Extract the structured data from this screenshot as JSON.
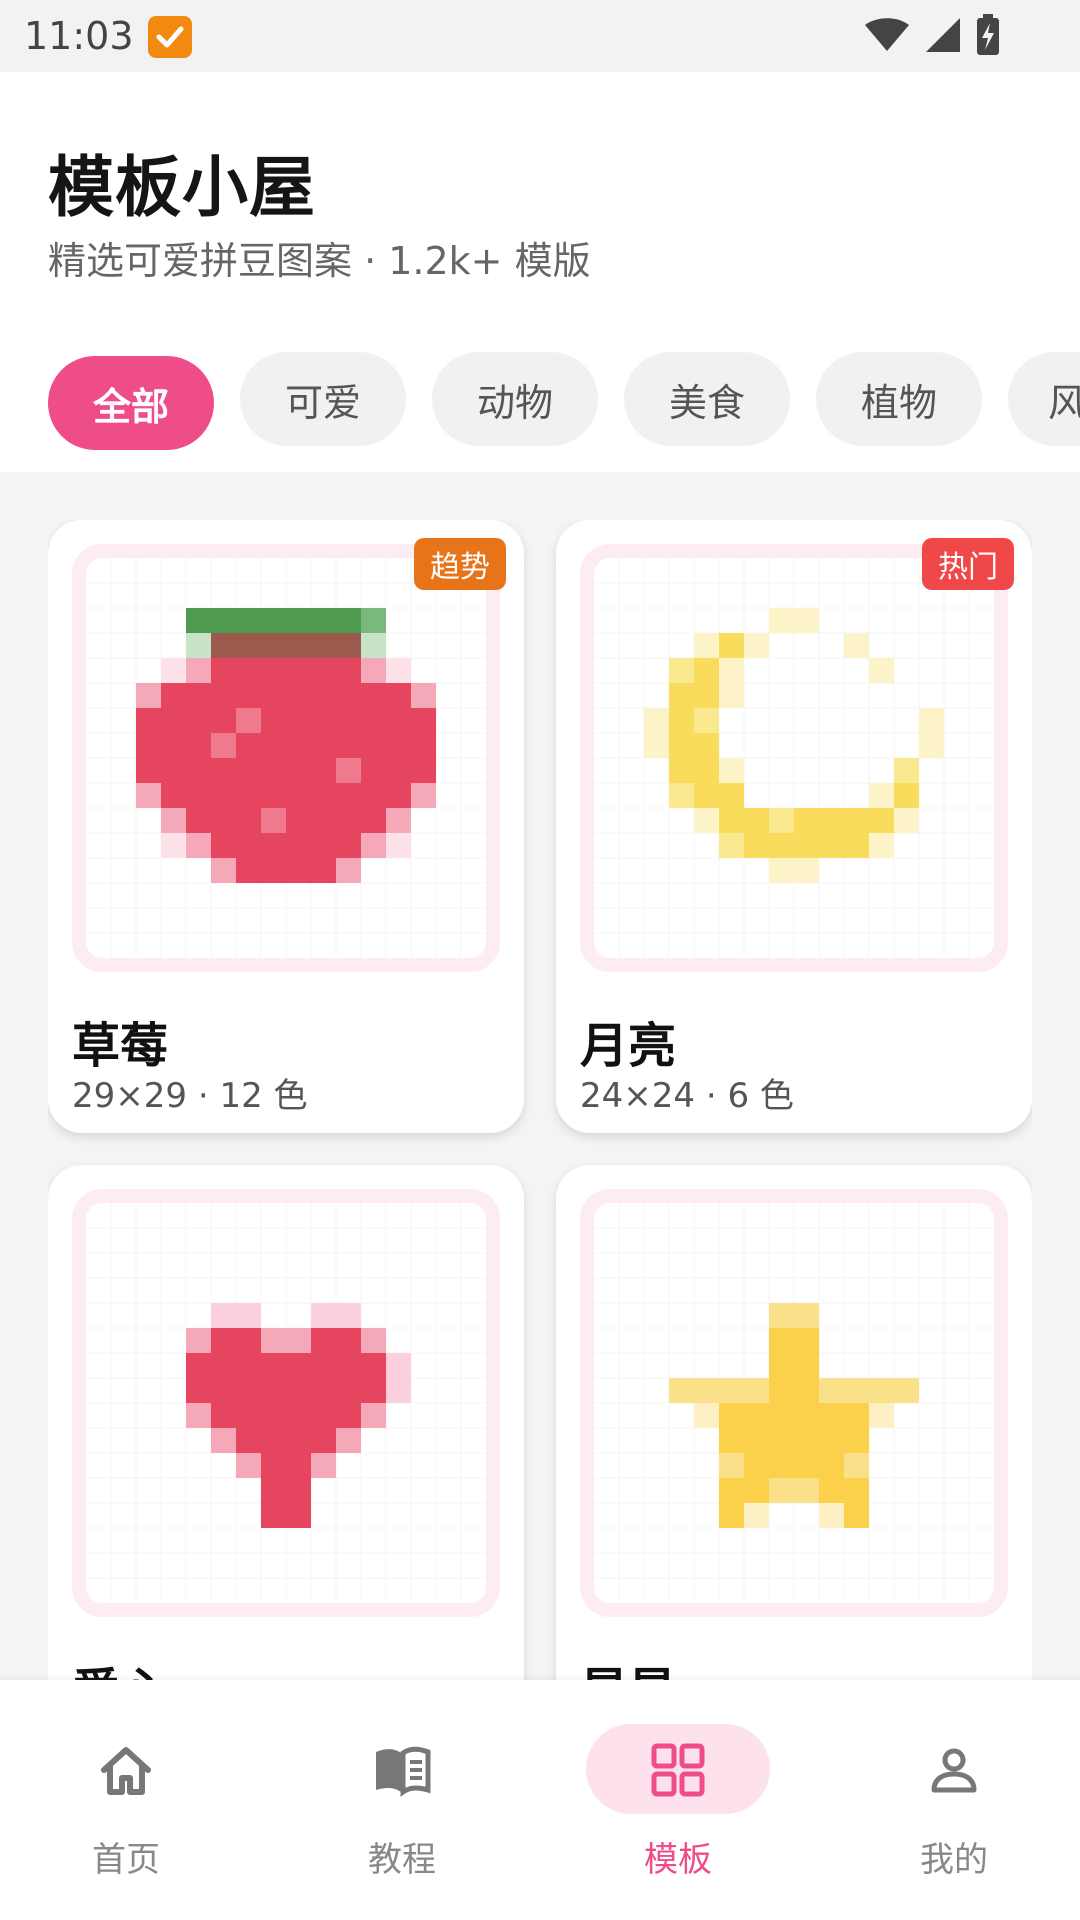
{
  "status_bar": {
    "time": "11:03"
  },
  "header": {
    "title": "模板小屋",
    "subtitle": "精选可爱拼豆图案 · 1.2k+ 模版"
  },
  "categories": [
    {
      "label": "全部",
      "active": true
    },
    {
      "label": "可爱",
      "active": false
    },
    {
      "label": "动物",
      "active": false
    },
    {
      "label": "美食",
      "active": false
    },
    {
      "label": "植物",
      "active": false
    },
    {
      "label": "风",
      "active": false
    }
  ],
  "templates": [
    {
      "title": "草莓",
      "meta": "29×29 · 12 色",
      "badge": "趋势",
      "badge_color": "#e8741a",
      "image_icon": "strawberry-pixel-icon"
    },
    {
      "title": "月亮",
      "meta": "24×24 · 6 色",
      "badge": "热门",
      "badge_color": "#f04848",
      "image_icon": "moon-pixel-icon"
    },
    {
      "title": "爱心",
      "meta": "",
      "badge": "",
      "image_icon": "heart-pixel-icon"
    },
    {
      "title": "星星",
      "meta": "",
      "badge": "",
      "image_icon": "star-pixel-icon"
    }
  ],
  "bottom_nav": [
    {
      "label": "首页",
      "icon": "home-icon",
      "active": false
    },
    {
      "label": "教程",
      "icon": "book-icon",
      "active": false
    },
    {
      "label": "模板",
      "icon": "grid-icon",
      "active": true
    },
    {
      "label": "我的",
      "icon": "user-icon",
      "active": false
    }
  ],
  "colors": {
    "accent": "#ee4d8a",
    "accent_light": "#fde1ec",
    "thumb_border": "#fdecf2"
  }
}
